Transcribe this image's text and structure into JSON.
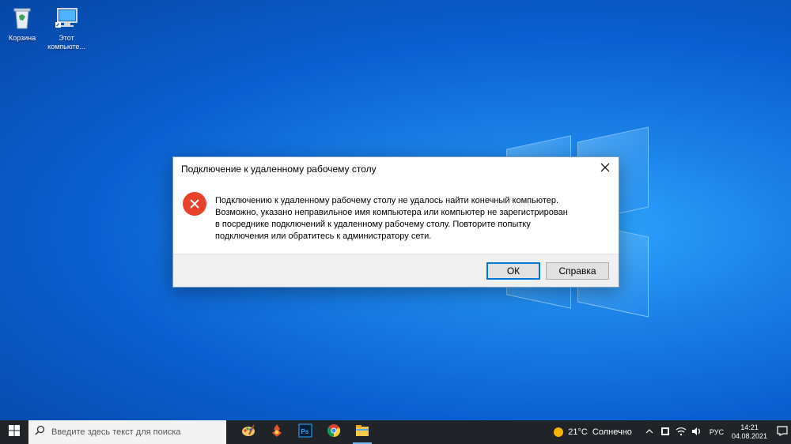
{
  "desktop": {
    "icons": [
      {
        "label": "Корзина"
      },
      {
        "label": "Этот компьюте..."
      }
    ]
  },
  "dialog": {
    "title": "Подключение к удаленному рабочему столу",
    "message": "Подключению к удаленному рабочему столу не удалось найти конечный компьютер.\nВозможно, указано неправильное имя компьютера или компьютер не зарегистрирован\nв посреднике подключений к удаленному рабочему столу. Повторите попытку\nподключения или обратитесь к администратору сети.",
    "ok_label": "ОК",
    "help_label": "Справка",
    "icon": "error-icon",
    "accent": "#0078d7",
    "error_color": "#e8412c"
  },
  "taskbar": {
    "search_placeholder": "Введите здесь текст для поиска",
    "apps": [
      "paint-icon",
      "game-icon",
      "photoshop-icon",
      "chrome-icon",
      "file-explorer-icon"
    ],
    "weather": {
      "temp": "21°C",
      "condition": "Солнечно"
    },
    "lang": "РУС",
    "time": "14:21",
    "date": "04.08.2021"
  }
}
